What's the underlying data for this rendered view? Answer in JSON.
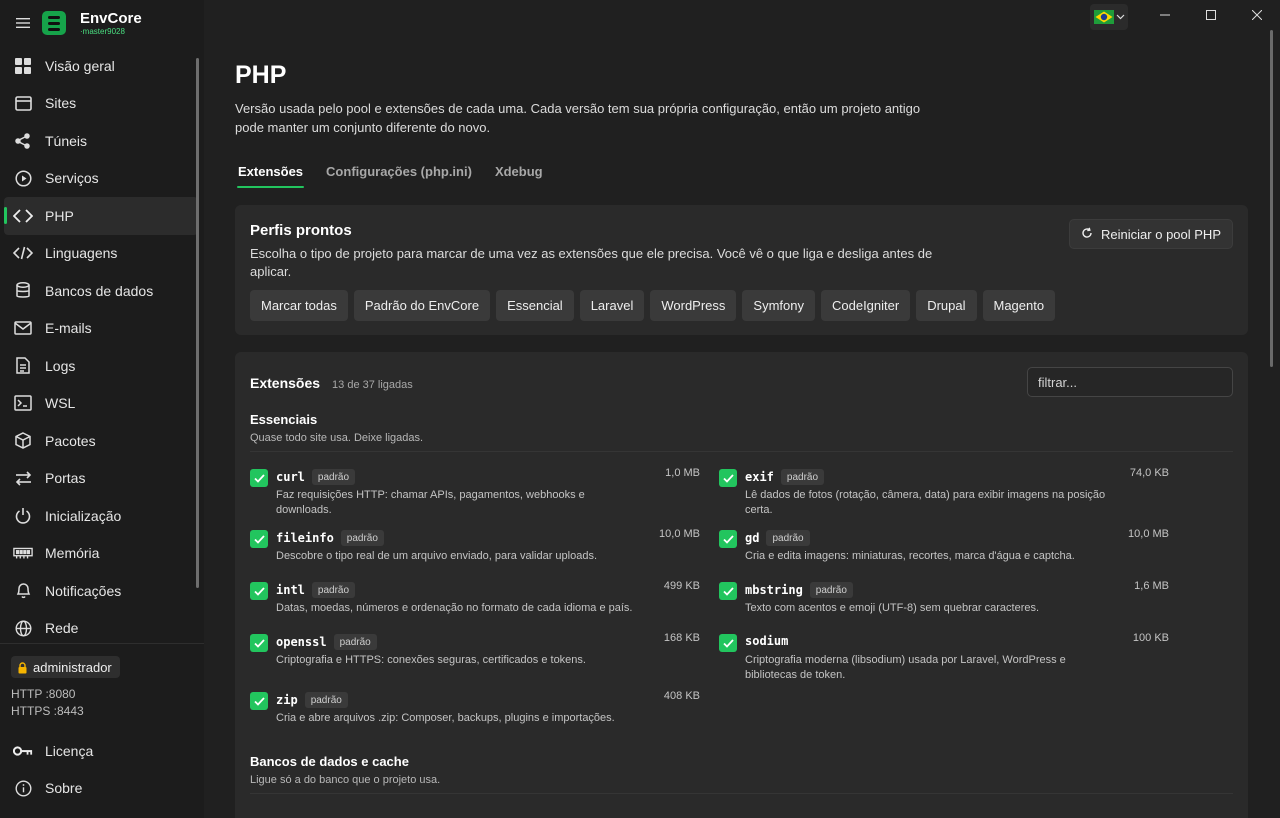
{
  "app": {
    "name": "EnvCore",
    "branch": "·master9028"
  },
  "sidebar": {
    "items": [
      {
        "label": "Visão geral",
        "icon": "grid-icon"
      },
      {
        "label": "Sites",
        "icon": "browser-icon"
      },
      {
        "label": "Túneis",
        "icon": "share-icon"
      },
      {
        "label": "Serviços",
        "icon": "play-circle-icon"
      },
      {
        "label": "PHP",
        "icon": "code-icon",
        "active": true
      },
      {
        "label": "Linguagens",
        "icon": "code-slash-icon"
      },
      {
        "label": "Bancos de dados",
        "icon": "database-icon"
      },
      {
        "label": "E-mails",
        "icon": "mail-icon"
      },
      {
        "label": "Logs",
        "icon": "document-icon"
      },
      {
        "label": "WSL",
        "icon": "terminal-icon"
      },
      {
        "label": "Pacotes",
        "icon": "package-icon"
      },
      {
        "label": "Portas",
        "icon": "swap-arrows-icon"
      },
      {
        "label": "Inicialização",
        "icon": "power-icon"
      },
      {
        "label": "Memória",
        "icon": "memory-icon"
      },
      {
        "label": "Notificações",
        "icon": "bell-icon"
      },
      {
        "label": "Rede",
        "icon": "globe-icon"
      }
    ],
    "user": "administrador",
    "http": "HTTP :8080",
    "https": "HTTPS :8443",
    "bottom": [
      {
        "label": "Licença",
        "icon": "key-icon"
      },
      {
        "label": "Sobre",
        "icon": "info-icon"
      }
    ]
  },
  "page": {
    "title": "PHP",
    "description": "Versão usada pelo pool e extensões de cada uma. Cada versão tem sua própria configuração, então um projeto antigo pode manter um conjunto diferente do novo.",
    "tabs": [
      "Extensões",
      "Configurações (php.ini)",
      "Xdebug"
    ]
  },
  "profiles": {
    "title": "Perfis prontos",
    "description": "Escolha o tipo de projeto para marcar de uma vez as extensões que ele precisa. Você vê o que liga e desliga antes de aplicar.",
    "restart_label": "Reiniciar o pool PHP",
    "buttons": [
      "Marcar todas",
      "Padrão do EnvCore",
      "Essencial",
      "Laravel",
      "WordPress",
      "Symfony",
      "CodeIgniter",
      "Drupal",
      "Magento"
    ]
  },
  "extensions": {
    "title": "Extensões",
    "count": "13 de 37 ligadas",
    "filter_placeholder": "filtrar...",
    "groups": [
      {
        "title": "Essenciais",
        "description": "Quase todo site usa. Deixe ligadas.",
        "items": [
          {
            "name": "curl",
            "badge": "padrão",
            "size": "1,0 MB",
            "desc": "Faz requisições HTTP: chamar APIs, pagamentos, webhooks e downloads."
          },
          {
            "name": "exif",
            "badge": "padrão",
            "size": "74,0 KB",
            "desc": "Lê dados de fotos (rotação, câmera, data) para exibir imagens na posição certa."
          },
          {
            "name": "fileinfo",
            "badge": "padrão",
            "size": "10,0 MB",
            "desc": "Descobre o tipo real de um arquivo enviado, para validar uploads."
          },
          {
            "name": "gd",
            "badge": "padrão",
            "size": "10,0 MB",
            "desc": "Cria e edita imagens: miniaturas, recortes, marca d'água e captcha."
          },
          {
            "name": "intl",
            "badge": "padrão",
            "size": "499 KB",
            "desc": "Datas, moedas, números e ordenação no formato de cada idioma e país."
          },
          {
            "name": "mbstring",
            "badge": "padrão",
            "size": "1,6 MB",
            "desc": "Texto com acentos e emoji (UTF-8) sem quebrar caracteres."
          },
          {
            "name": "openssl",
            "badge": "padrão",
            "size": "168 KB",
            "desc": "Criptografia e HTTPS: conexões seguras, certificados e tokens."
          },
          {
            "name": "sodium",
            "badge": "",
            "size": "100 KB",
            "desc": "Criptografia moderna (libsodium) usada por Laravel, WordPress e bibliotecas de token."
          },
          {
            "name": "zip",
            "badge": "padrão",
            "size": "408 KB",
            "desc": "Cria e abre arquivos .zip: Composer, backups, plugins e importações."
          }
        ]
      },
      {
        "title": "Bancos de dados e cache",
        "description": "Ligue só a do banco que o projeto usa."
      }
    ]
  }
}
